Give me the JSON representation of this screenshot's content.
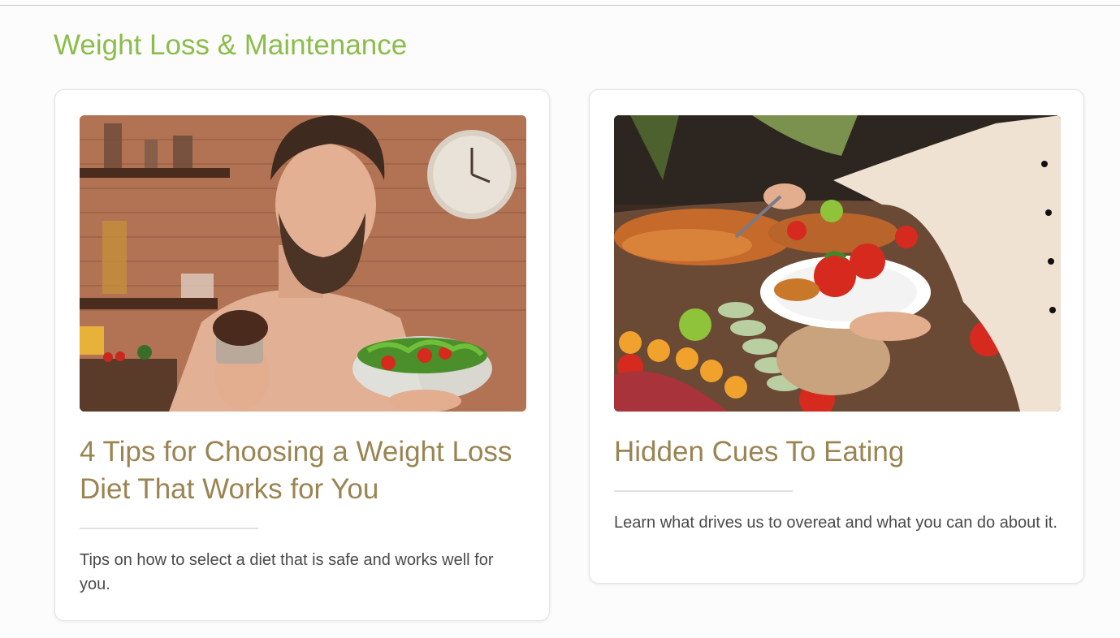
{
  "section": {
    "title": "Weight Loss & Maintenance"
  },
  "articles": [
    {
      "title": "4 Tips for Choosing a Weight Loss Diet That Works for You",
      "description": "Tips on how to select a diet that is safe and works well for you.",
      "image_alt": "Man holding a chocolate muffin and a bowl of salad"
    },
    {
      "title": "Hidden Cues To Eating",
      "description": "Learn what drives us to overeat and what you can do about it.",
      "image_alt": "Chef serving a plate from a large buffet"
    }
  ],
  "colors": {
    "section_title": "#8bbd4a",
    "article_title": "#9a8452",
    "body_text": "#4a4a4a"
  }
}
